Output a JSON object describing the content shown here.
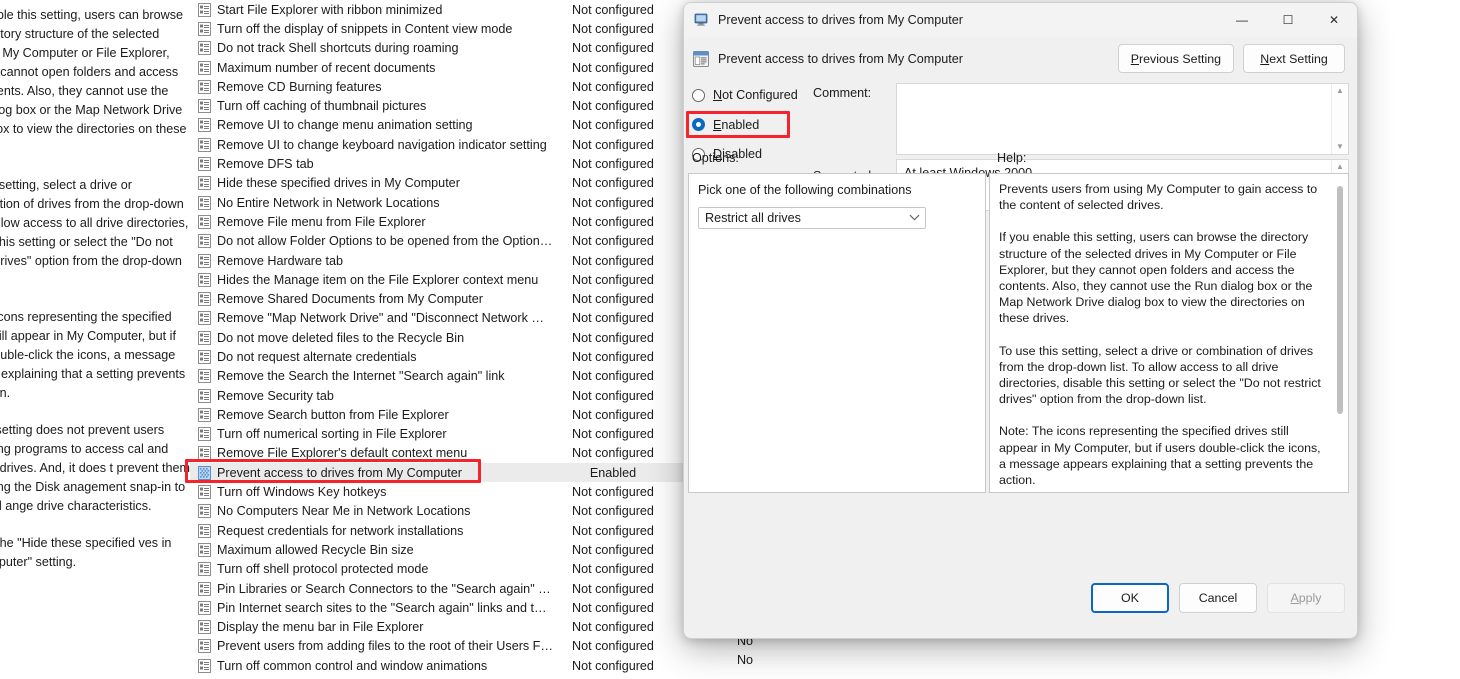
{
  "background": {
    "left_pane_paragraphs": [
      "you enable this setting, users can browse the directory structure of the selected drives in My Computer or File Explorer, but they cannot open folders and access the contents. Also, they cannot use the Run dialog box or the Map Network Drive dialog box to view the directories on these drives.",
      "use this setting, select a drive or combination of drives from the drop-down list. To allow access to all drive directories, disable this setting or select the \"Do not restrict drives\" option from the drop-down list.",
      "te: The icons representing the specified drives still appear in My Computer, but if users double-click the icons, a message appears explaining that a setting prevents the action.",
      "so, this setting does not prevent users from using programs to access cal and network drives. And, it does t prevent them from using the Disk anagement snap-in to view and ange drive characteristics.",
      "so, see the \"Hide these specified ves in My Computer\" setting."
    ],
    "state_not_configured": "Not configured",
    "state_enabled": "Enabled",
    "state_no": "No",
    "policy_rows": [
      {
        "name": "Start File Explorer with ribbon minimized",
        "state": "Not configured",
        "selected": false
      },
      {
        "name": "Turn off the display of snippets in Content view mode",
        "state": "Not configured",
        "selected": false
      },
      {
        "name": "Do not track Shell shortcuts during roaming",
        "state": "Not configured",
        "selected": false
      },
      {
        "name": "Maximum number of recent documents",
        "state": "Not configured",
        "selected": false
      },
      {
        "name": "Remove CD Burning features",
        "state": "Not configured",
        "selected": false
      },
      {
        "name": "Turn off caching of thumbnail pictures",
        "state": "Not configured",
        "selected": false
      },
      {
        "name": "Remove UI to change menu animation setting",
        "state": "Not configured",
        "selected": false
      },
      {
        "name": "Remove UI to change keyboard navigation indicator setting",
        "state": "Not configured",
        "selected": false
      },
      {
        "name": "Remove DFS tab",
        "state": "Not configured",
        "selected": false
      },
      {
        "name": "Hide these specified drives in My Computer",
        "state": "Not configured",
        "selected": false
      },
      {
        "name": "No Entire Network in Network Locations",
        "state": "Not configured",
        "selected": false
      },
      {
        "name": "Remove File menu from File Explorer",
        "state": "Not configured",
        "selected": false
      },
      {
        "name": "Do not allow Folder Options to be opened from the Options...",
        "state": "Not configured",
        "selected": false
      },
      {
        "name": "Remove Hardware tab",
        "state": "Not configured",
        "selected": false
      },
      {
        "name": "Hides the Manage item on the File Explorer context menu",
        "state": "Not configured",
        "selected": false
      },
      {
        "name": "Remove Shared Documents from My Computer",
        "state": "Not configured",
        "selected": false
      },
      {
        "name": "Remove \"Map Network Drive\" and \"Disconnect Network Dri...",
        "state": "Not configured",
        "selected": false
      },
      {
        "name": "Do not move deleted files to the Recycle Bin",
        "state": "Not configured",
        "selected": false
      },
      {
        "name": "Do not request alternate credentials",
        "state": "Not configured",
        "selected": false
      },
      {
        "name": "Remove the Search the Internet \"Search again\" link",
        "state": "Not configured",
        "selected": false
      },
      {
        "name": "Remove Security tab",
        "state": "Not configured",
        "selected": false
      },
      {
        "name": "Remove Search button from File Explorer",
        "state": "Not configured",
        "selected": false
      },
      {
        "name": "Turn off numerical sorting in File Explorer",
        "state": "Not configured",
        "selected": false
      },
      {
        "name": "Remove File Explorer's default context menu",
        "state": "Not configured",
        "selected": false
      },
      {
        "name": "Prevent access to drives from My Computer",
        "state": "Enabled",
        "selected": true
      },
      {
        "name": "Turn off Windows Key hotkeys",
        "state": "Not configured",
        "selected": false
      },
      {
        "name": "No Computers Near Me in Network Locations",
        "state": "Not configured",
        "selected": false
      },
      {
        "name": "Request credentials for network installations",
        "state": "Not configured",
        "selected": false
      },
      {
        "name": "Maximum allowed Recycle Bin size",
        "state": "Not configured",
        "selected": false
      },
      {
        "name": "Turn off shell protocol protected mode",
        "state": "Not configured",
        "selected": false
      },
      {
        "name": "Pin Libraries or Search Connectors to the \"Search again\" link...",
        "state": "Not configured",
        "selected": false
      },
      {
        "name": "Pin Internet search sites to the \"Search again\" links and the S...",
        "state": "Not configured",
        "selected": false
      },
      {
        "name": "Display the menu bar in File Explorer",
        "state": "Not configured",
        "selected": false
      },
      {
        "name": "Prevent users from adding files to the root of their Users File...",
        "state": "Not configured",
        "selected": false
      },
      {
        "name": "Turn off common control and window animations",
        "state": "Not configured",
        "selected": false
      }
    ],
    "occluded_states": [
      "No",
      "No"
    ]
  },
  "dialog": {
    "title": "Prevent access to drives from My Computer",
    "header_title": "Prevent access to drives from My Computer",
    "window_buttons": {
      "minimize": "—",
      "maximize": "☐",
      "close": "✕"
    },
    "previous_setting": {
      "accel": "P",
      "rest": "revious Setting"
    },
    "next_setting": {
      "accel": "N",
      "rest": "ext Setting"
    },
    "states": [
      {
        "label_accel": "N",
        "label_pre": "",
        "label_rest": "ot Configured",
        "full": "Not Configured",
        "checked": false
      },
      {
        "label_accel": "E",
        "label_pre": "",
        "label_rest": "nabled",
        "full": "Enabled",
        "checked": true
      },
      {
        "label_accel": "D",
        "label_pre": "",
        "label_rest": "isabled",
        "full": "Disabled",
        "checked": false
      }
    ],
    "comment_label": "Comment:",
    "comment_value": "",
    "supported_label": "Supported on:",
    "supported_value": "At least Windows 2000",
    "options_label": "Options:",
    "help_label": "Help:",
    "options": {
      "pick_label": "Pick one of the following combinations",
      "selected_value": "Restrict all drives",
      "chevron": "⌄"
    },
    "help_paragraphs": [
      "Prevents users from using My Computer to gain access to the content of selected drives.",
      "If you enable this setting, users can browse the directory structure of the selected drives in My Computer or File Explorer, but they cannot open folders and access the contents. Also, they cannot use the Run dialog box or the Map Network Drive dialog box to view the directories on these drives.",
      "To use this setting, select a drive or combination of drives from the drop-down list. To allow access to all drive directories, disable this setting or select the \"Do not restrict drives\" option from the drop-down list.",
      "Note: The icons representing the specified drives still appear in My Computer, but if users double-click the icons, a message appears explaining that a setting prevents the action.",
      " Also, this setting does not prevent users from using programs to access local and network drives. And, it does not prevent them from using the Disk Management snap-in to view and change"
    ],
    "footer": {
      "ok": "OK",
      "cancel": "Cancel",
      "apply_accel": "A",
      "apply_rest": "pply"
    }
  },
  "colors": {
    "accent": "#0a67c2",
    "annotation_red": "#f4232c",
    "dialog_bg": "#f0f0f0",
    "selection_bg": "#ebebeb"
  }
}
